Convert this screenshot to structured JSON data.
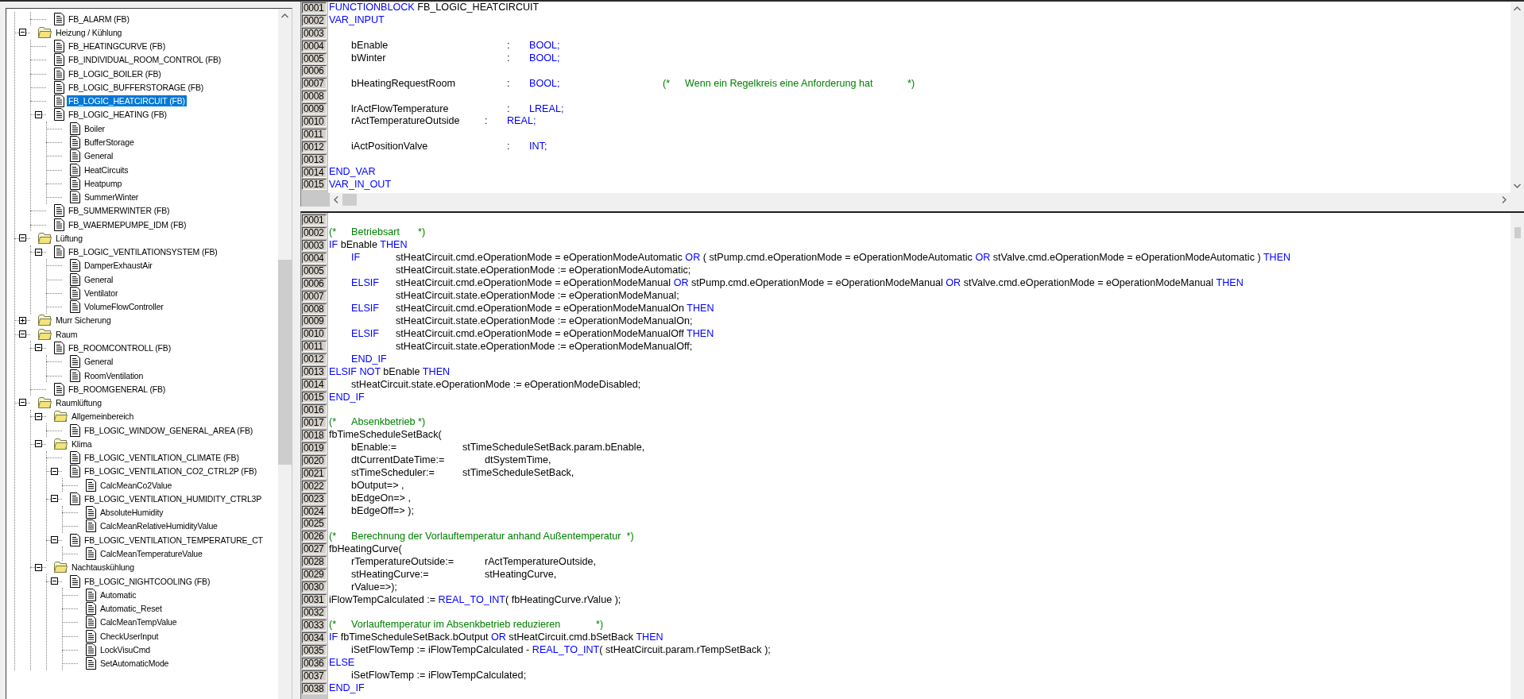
{
  "tree": {
    "items": [
      {
        "children": [
          {
            "label": "FB_ALARM (FB)",
            "kind": "object",
            "selected": false
          }
        ]
      },
      {
        "label": "Heizung / Kühlung",
        "kind": "folder",
        "selected": false,
        "expanded": true,
        "children": [
          {
            "label": "FB_HEATINGCURVE (FB)",
            "kind": "object",
            "selected": false
          },
          {
            "label": "FB_INDIVIDUAL_ROOM_CONTROL (FB)",
            "kind": "object",
            "selected": false
          },
          {
            "label": "FB_LOGIC_BOILER (FB)",
            "kind": "object",
            "selected": false
          },
          {
            "label": "FB_LOGIC_BUFFERSTORAGE (FB)",
            "kind": "object",
            "selected": false
          },
          {
            "label": "FB_LOGIC_HEATCIRCUIT (FB)",
            "kind": "object",
            "selected": true
          },
          {
            "label": "FB_LOGIC_HEATING (FB)",
            "kind": "object",
            "selected": false,
            "expanded": true,
            "children": [
              {
                "label": "Boiler",
                "kind": "object",
                "selected": false
              },
              {
                "label": "BufferStorage",
                "kind": "object",
                "selected": false
              },
              {
                "label": "General",
                "kind": "object",
                "selected": false
              },
              {
                "label": "HeatCircuits",
                "kind": "object",
                "selected": false
              },
              {
                "label": "Heatpump",
                "kind": "object",
                "selected": false
              },
              {
                "label": "SummerWinter",
                "kind": "object",
                "selected": false
              }
            ]
          },
          {
            "label": "FB_SUMMERWINTER (FB)",
            "kind": "object",
            "selected": false
          },
          {
            "label": "FB_WAERMEPUMPE_IDM (FB)",
            "kind": "object",
            "selected": false
          }
        ]
      },
      {
        "label": "Lüftung",
        "kind": "folder",
        "selected": false,
        "expanded": true,
        "children": [
          {
            "label": "FB_LOGIC_VENTILATIONSYSTEM (FB)",
            "kind": "object",
            "selected": false,
            "expanded": true,
            "children": [
              {
                "label": "DamperExhaustAir",
                "kind": "object",
                "selected": false
              },
              {
                "label": "General",
                "kind": "object",
                "selected": false
              },
              {
                "label": "Ventilator",
                "kind": "object",
                "selected": false
              },
              {
                "label": "VolumeFlowController",
                "kind": "object",
                "selected": false
              }
            ]
          }
        ]
      },
      {
        "label": "Murr Sicherung",
        "kind": "folder",
        "selected": false,
        "expanded": false
      },
      {
        "label": "Raum",
        "kind": "folder",
        "selected": false,
        "expanded": true,
        "children": [
          {
            "label": "FB_ROOMCONTROLL (FB)",
            "kind": "object",
            "selected": false,
            "expanded": true,
            "children": [
              {
                "label": "General",
                "kind": "object",
                "selected": false
              },
              {
                "label": "RoomVentilation",
                "kind": "object",
                "selected": false
              }
            ]
          },
          {
            "label": "FB_ROOMGENERAL (FB)",
            "kind": "object",
            "selected": false
          }
        ]
      },
      {
        "label": "Raumlüftung",
        "kind": "folder",
        "selected": false,
        "expanded": true,
        "children": [
          {
            "label": "Allgemeinbereich",
            "kind": "folder",
            "selected": false,
            "expanded": true,
            "children": [
              {
                "label": "FB_LOGIC_WINDOW_GENERAL_AREA (FB)",
                "kind": "object",
                "selected": false
              }
            ]
          },
          {
            "label": "Klima",
            "kind": "folder",
            "selected": false,
            "expanded": true,
            "children": [
              {
                "label": "FB_LOGIC_VENTILATION_CLIMATE (FB)",
                "kind": "object",
                "selected": false
              },
              {
                "label": "FB_LOGIC_VENTILATION_CO2_CTRL2P (FB)",
                "kind": "object",
                "selected": false,
                "expanded": true,
                "children": [
                  {
                    "label": "CalcMeanCo2Value",
                    "kind": "object",
                    "selected": false
                  }
                ]
              },
              {
                "label": "FB_LOGIC_VENTILATION_HUMIDITY_CTRL3P",
                "kind": "object",
                "selected": false,
                "expanded": true,
                "children": [
                  {
                    "label": "AbsoluteHumidity",
                    "kind": "object",
                    "selected": false
                  },
                  {
                    "label": "CalcMeanRelativeHumidityValue",
                    "kind": "object",
                    "selected": false
                  }
                ]
              },
              {
                "label": "FB_LOGIC_VENTILATION_TEMPERATURE_CT",
                "kind": "object",
                "selected": false,
                "expanded": true,
                "children": [
                  {
                    "label": "CalcMeanTemperatureValue",
                    "kind": "object",
                    "selected": false
                  }
                ]
              }
            ]
          },
          {
            "label": "Nachtauskühlung",
            "kind": "folder",
            "selected": false,
            "expanded": true,
            "children": [
              {
                "label": "FB_LOGIC_NIGHTCOOLING (FB)",
                "kind": "object",
                "selected": false,
                "expanded": true,
                "children": [
                  {
                    "label": "Automatic",
                    "kind": "object",
                    "selected": false
                  },
                  {
                    "label": "Automatic_Reset",
                    "kind": "object",
                    "selected": false
                  },
                  {
                    "label": "CalcMeanTempValue",
                    "kind": "object",
                    "selected": false
                  },
                  {
                    "label": "CheckUserInput",
                    "kind": "object",
                    "selected": false
                  },
                  {
                    "label": "LockVisuCmd",
                    "kind": "object",
                    "selected": false
                  },
                  {
                    "label": "SetAutomaticMode",
                    "kind": "object",
                    "selected": false
                  }
                ]
              }
            ]
          }
        ]
      }
    ]
  },
  "declaration_editor": {
    "lines": [
      {
        "number": "0001",
        "parts": [
          {
            "kind": "keyword",
            "text": "FUNCTIONBLOCK"
          },
          {
            "kind": "plain",
            "text": " FB_LOGIC_HEATCIRCUIT"
          }
        ]
      },
      {
        "number": "0002",
        "parts": [
          {
            "kind": "keyword",
            "text": "VAR_INPUT"
          }
        ]
      },
      {
        "number": "0003"
      },
      {
        "number": "0004",
        "parts": [
          {
            "kind": "plain",
            "text": "\tbEnable\t\t\t\t\t\t:\t"
          },
          {
            "kind": "keyword",
            "text": "BOOL;"
          }
        ]
      },
      {
        "number": "0005",
        "parts": [
          {
            "kind": "plain",
            "text": "\tbWinter\t\t\t\t\t\t:\t"
          },
          {
            "kind": "keyword",
            "text": "BOOL;"
          }
        ]
      },
      {
        "number": "0006"
      },
      {
        "number": "0007",
        "parts": [
          {
            "kind": "plain",
            "text": "\tbHeatingRequestRoom\t\t\t:\t"
          },
          {
            "kind": "keyword",
            "text": "BOOL;"
          },
          {
            "kind": "comment",
            "text": "\t\t\t\t\t(*\tWenn ein Regelkreis eine Anforderung hat\t\t*)"
          }
        ]
      },
      {
        "number": "0008"
      },
      {
        "number": "0009",
        "parts": [
          {
            "kind": "plain",
            "text": "\tlrActFlowTemperature\t\t\t:\t"
          },
          {
            "kind": "keyword",
            "text": "LREAL;"
          }
        ]
      },
      {
        "number": "0010",
        "parts": [
          {
            "kind": "plain",
            "text": "\trActTemperatureOutside\t\t:\t"
          },
          {
            "kind": "keyword",
            "text": "REAL;"
          }
        ]
      },
      {
        "number": "0011"
      },
      {
        "number": "0012",
        "parts": [
          {
            "kind": "plain",
            "text": "\tiActPositionValve\t\t\t\t:\t"
          },
          {
            "kind": "keyword",
            "text": "INT;"
          }
        ]
      },
      {
        "number": "0013"
      },
      {
        "number": "0014",
        "parts": [
          {
            "kind": "keyword",
            "text": "END_VAR"
          }
        ]
      },
      {
        "number": "0015",
        "parts": [
          {
            "kind": "keyword",
            "text": "VAR_IN_OUT"
          }
        ]
      }
    ]
  },
  "body_editor": {
    "lines": [
      {
        "number": "0001"
      },
      {
        "number": "0002",
        "parts": [
          {
            "kind": "comment",
            "text": "(*\tBetriebsart\t*)"
          }
        ]
      },
      {
        "number": "0003",
        "parts": [
          {
            "kind": "keyword",
            "text": "IF"
          },
          {
            "kind": "plain",
            "text": " bEnable "
          },
          {
            "kind": "keyword",
            "text": "THEN"
          }
        ]
      },
      {
        "number": "0004",
        "parts": [
          {
            "kind": "keyword",
            "text": "\tIF"
          },
          {
            "kind": "plain",
            "text": "\t\tstHeatCircuit.cmd.eOperationMode = eOperationModeAutomatic "
          },
          {
            "kind": "keyword",
            "text": "OR"
          },
          {
            "kind": "plain",
            "text": " ( stPump.cmd.eOperationMode = eOperationModeAutomatic "
          },
          {
            "kind": "keyword",
            "text": "OR"
          },
          {
            "kind": "plain",
            "text": " stValve.cmd.eOperationMode = eOperationModeAutomatic ) "
          },
          {
            "kind": "keyword",
            "text": "THEN"
          }
        ]
      },
      {
        "number": "0005",
        "parts": [
          {
            "kind": "plain",
            "text": "\t\t\tstHeatCircuit.state.eOperationMode := eOperationModeAutomatic;"
          }
        ]
      },
      {
        "number": "0006",
        "parts": [
          {
            "kind": "keyword",
            "text": "\tELSIF"
          },
          {
            "kind": "plain",
            "text": "\tstHeatCircuit.cmd.eOperationMode = eOperationModeManual "
          },
          {
            "kind": "keyword",
            "text": "OR"
          },
          {
            "kind": "plain",
            "text": " stPump.cmd.eOperationMode = eOperationModeManual "
          },
          {
            "kind": "keyword",
            "text": "OR"
          },
          {
            "kind": "plain",
            "text": " stValve.cmd.eOperationMode = eOperationModeManual "
          },
          {
            "kind": "keyword",
            "text": "THEN"
          }
        ]
      },
      {
        "number": "0007",
        "parts": [
          {
            "kind": "plain",
            "text": "\t\t\tstHeatCircuit.state.eOperationMode := eOperationModeManual;"
          }
        ]
      },
      {
        "number": "0008",
        "parts": [
          {
            "kind": "keyword",
            "text": "\tELSIF"
          },
          {
            "kind": "plain",
            "text": "\tstHeatCircuit.cmd.eOperationMode = eOperationModeManualOn "
          },
          {
            "kind": "keyword",
            "text": "THEN"
          }
        ]
      },
      {
        "number": "0009",
        "parts": [
          {
            "kind": "plain",
            "text": "\t\t\tstHeatCircuit.state.eOperationMode := eOperationModeManualOn;"
          }
        ]
      },
      {
        "number": "0010",
        "parts": [
          {
            "kind": "keyword",
            "text": "\tELSIF"
          },
          {
            "kind": "plain",
            "text": "\tstHeatCircuit.cmd.eOperationMode = eOperationModeManualOff "
          },
          {
            "kind": "keyword",
            "text": "THEN"
          }
        ]
      },
      {
        "number": "0011",
        "parts": [
          {
            "kind": "plain",
            "text": "\t\t\tstHeatCircuit.state.eOperationMode := eOperationModeManualOff;"
          }
        ]
      },
      {
        "number": "0012",
        "parts": [
          {
            "kind": "keyword",
            "text": "\tEND_IF"
          }
        ]
      },
      {
        "number": "0013",
        "parts": [
          {
            "kind": "keyword",
            "text": "ELSIF NOT"
          },
          {
            "kind": "plain",
            "text": " bEnable "
          },
          {
            "kind": "keyword",
            "text": "THEN"
          }
        ]
      },
      {
        "number": "0014",
        "parts": [
          {
            "kind": "plain",
            "text": "\tstHeatCircuit.state.eOperationMode := eOperationModeDisabled;"
          }
        ]
      },
      {
        "number": "0015",
        "parts": [
          {
            "kind": "keyword",
            "text": "END_IF"
          }
        ]
      },
      {
        "number": "0016"
      },
      {
        "number": "0017",
        "parts": [
          {
            "kind": "comment",
            "text": "(*\tAbsenkbetrieb\t*)"
          }
        ]
      },
      {
        "number": "0018",
        "parts": [
          {
            "kind": "plain",
            "text": "fbTimeScheduleSetBack("
          }
        ]
      },
      {
        "number": "0019",
        "parts": [
          {
            "kind": "plain",
            "text": "\tbEnable:=\t\t\tstTimeScheduleSetBack.param.bEnable,"
          }
        ]
      },
      {
        "number": "0020",
        "parts": [
          {
            "kind": "plain",
            "text": "\tdtCurrentDateTime:=\t\tdtSystemTime,"
          }
        ]
      },
      {
        "number": "0021",
        "parts": [
          {
            "kind": "plain",
            "text": "\tstTimeScheduler:=\t\tstTimeScheduleSetBack,"
          }
        ]
      },
      {
        "number": "0022",
        "parts": [
          {
            "kind": "plain",
            "text": "\tbOutput=> ,"
          }
        ]
      },
      {
        "number": "0023",
        "parts": [
          {
            "kind": "plain",
            "text": "\tbEdgeOn=> ,"
          }
        ]
      },
      {
        "number": "0024",
        "parts": [
          {
            "kind": "plain",
            "text": "\tbEdgeOff=> );"
          }
        ]
      },
      {
        "number": "0025"
      },
      {
        "number": "0026",
        "parts": [
          {
            "kind": "comment",
            "text": "(*\tBerechnung der Vorlauftemperatur anhand Außentemperatur  *)"
          }
        ]
      },
      {
        "number": "0027",
        "parts": [
          {
            "kind": "plain",
            "text": "fbHeatingCurve("
          }
        ]
      },
      {
        "number": "0028",
        "parts": [
          {
            "kind": "plain",
            "text": "\trTemperatureOutside:=\t\trActTemperatureOutside,"
          }
        ]
      },
      {
        "number": "0029",
        "parts": [
          {
            "kind": "plain",
            "text": "\tstHeatingCurve:=\t\t\tstHeatingCurve,"
          }
        ]
      },
      {
        "number": "0030",
        "parts": [
          {
            "kind": "plain",
            "text": "\trValue=>);"
          }
        ]
      },
      {
        "number": "0031",
        "parts": [
          {
            "kind": "plain",
            "text": "iFlowTempCalculated := "
          },
          {
            "kind": "keyword",
            "text": "REAL_TO_INT"
          },
          {
            "kind": "plain",
            "text": "( fbHeatingCurve.rValue );"
          }
        ]
      },
      {
        "number": "0032"
      },
      {
        "number": "0033",
        "parts": [
          {
            "kind": "comment",
            "text": "(*\tVorlauftemperatur im Absenkbetrieb reduzieren\t\t*)"
          }
        ]
      },
      {
        "number": "0034",
        "parts": [
          {
            "kind": "keyword",
            "text": "IF"
          },
          {
            "kind": "plain",
            "text": " fbTimeScheduleSetBack.bOutput "
          },
          {
            "kind": "keyword",
            "text": "OR"
          },
          {
            "kind": "plain",
            "text": " stHeatCircuit.cmd.bSetBack "
          },
          {
            "kind": "keyword",
            "text": "THEN"
          }
        ]
      },
      {
        "number": "0035",
        "parts": [
          {
            "kind": "plain",
            "text": "\tiSetFlowTemp := iFlowTempCalculated - "
          },
          {
            "kind": "keyword",
            "text": "REAL_TO_INT"
          },
          {
            "kind": "plain",
            "text": "( stHeatCircuit.param.rTempSetBack );"
          }
        ]
      },
      {
        "number": "0036",
        "parts": [
          {
            "kind": "keyword",
            "text": "ELSE"
          }
        ]
      },
      {
        "number": "0037",
        "parts": [
          {
            "kind": "plain",
            "text": "\tiSetFlowTemp := iFlowTempCalculated;"
          }
        ]
      },
      {
        "number": "0038",
        "parts": [
          {
            "kind": "keyword",
            "text": "END_IF"
          }
        ]
      }
    ]
  }
}
